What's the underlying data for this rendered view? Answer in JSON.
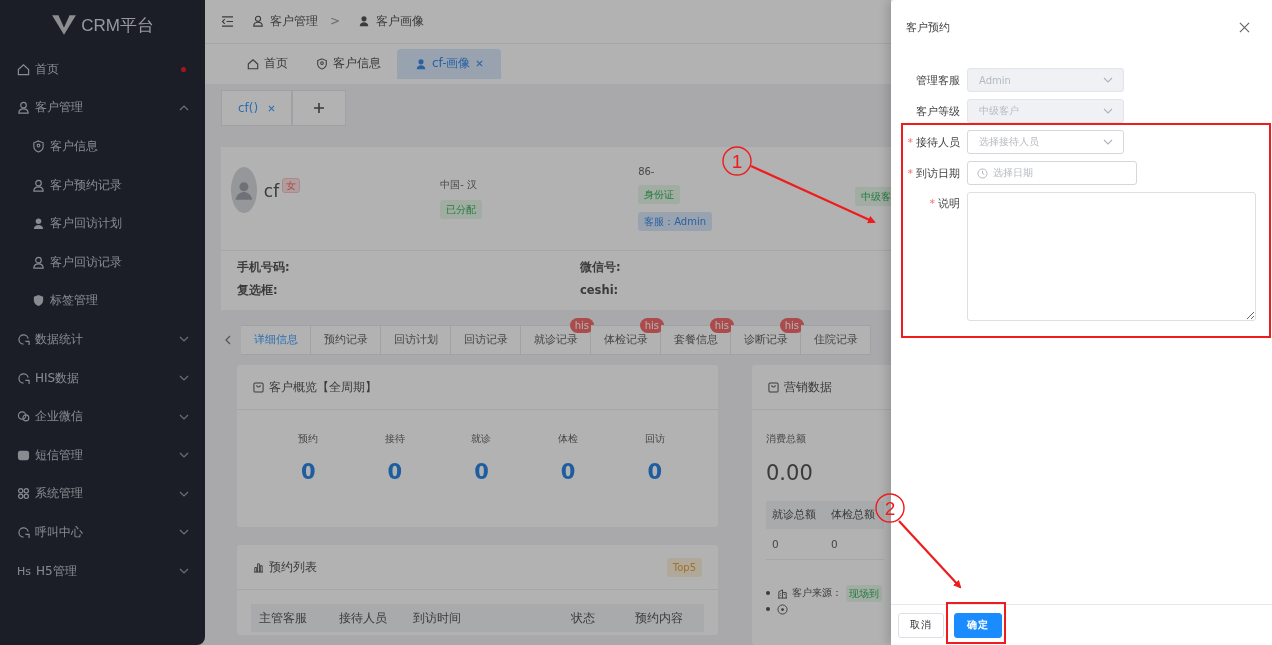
{
  "sidebar": {
    "logo": "CRM平台",
    "items": [
      {
        "label": "首页",
        "dot": true
      },
      {
        "label": "客户管理",
        "expanded": true,
        "children": [
          {
            "label": "客户信息",
            "selected": false
          },
          {
            "label": "客户预约记录",
            "selected": false
          },
          {
            "label": "客户回访计划",
            "selected": false
          },
          {
            "label": "客户回访记录",
            "selected": false
          },
          {
            "label": "标签管理",
            "selected": false
          }
        ]
      },
      {
        "label": "数据统计",
        "expanded": false
      },
      {
        "label": "HIS数据",
        "expanded": false
      },
      {
        "label": "企业微信",
        "expanded": false
      },
      {
        "label": "短信管理",
        "expanded": false
      },
      {
        "label": "系统管理",
        "expanded": false
      },
      {
        "label": "呼叫中心",
        "expanded": false
      },
      {
        "label": "H5管理",
        "icon_text": "Hs",
        "expanded": false
      }
    ]
  },
  "breadcrumb": {
    "items": [
      "客户管理",
      "客户画像"
    ],
    "separator": ">"
  },
  "tabs": [
    {
      "label": "首页",
      "selected": false,
      "closable": false
    },
    {
      "label": "客户信息",
      "selected": false,
      "closable": false
    },
    {
      "label": "cf-画像",
      "selected": true,
      "closable": true
    }
  ],
  "sub_tabs": [
    {
      "label": "cf()",
      "selected": true,
      "closable": true
    }
  ],
  "profile": {
    "name": "cf",
    "gender": "女",
    "origin": "中国- 汉",
    "status_tag": "已分配",
    "phone_code": "86-",
    "id_tag": "身份证",
    "staff_tag": "客服：Admin",
    "level_tag": "中级客",
    "fields": [
      {
        "label": "手机号码:"
      },
      {
        "label": "微信号:"
      },
      {
        "label": "复选框:"
      },
      {
        "label": "ceshi:"
      }
    ]
  },
  "detail_tabs": [
    {
      "label": "详细信息",
      "selected": true
    },
    {
      "label": "预约记录",
      "selected": false
    },
    {
      "label": "回访计划",
      "selected": false
    },
    {
      "label": "回访记录",
      "selected": false
    },
    {
      "label": "就诊记录",
      "selected": false,
      "badge": "his"
    },
    {
      "label": "体检记录",
      "selected": false,
      "badge": "his"
    },
    {
      "label": "套餐信息",
      "selected": false,
      "badge": "his"
    },
    {
      "label": "诊断记录",
      "selected": false,
      "badge": "his"
    },
    {
      "label": "住院记录",
      "selected": false
    }
  ],
  "overview": {
    "title": "客户概览【全周期】",
    "stats": [
      {
        "label": "预约",
        "value": "0"
      },
      {
        "label": "接待",
        "value": "0"
      },
      {
        "label": "就诊",
        "value": "0"
      },
      {
        "label": "体检",
        "value": "0"
      },
      {
        "label": "回访",
        "value": "0"
      }
    ]
  },
  "appointments": {
    "title": "预约列表",
    "tag": "Top5",
    "columns": [
      "主管客服",
      "接待人员",
      "到访时间",
      "状态",
      "预约内容"
    ]
  },
  "marketing": {
    "title": "营销数据",
    "total_label": "消费总额",
    "total": "0.00",
    "columns": [
      "就诊总额",
      "体检总额"
    ],
    "row": [
      "0",
      "0"
    ],
    "list": [
      {
        "kind": "source",
        "label": "客户来源：",
        "tag": "现场到"
      },
      {
        "kind": "location"
      }
    ]
  },
  "drawer": {
    "title": "客户预约",
    "required_mark": "*",
    "fields": [
      {
        "kind": "select",
        "label": "管理客服",
        "value": "Admin",
        "required": false,
        "disabled": true
      },
      {
        "kind": "select",
        "label": "客户等级",
        "value": "中级客户",
        "required": false,
        "disabled": true
      },
      {
        "kind": "select",
        "label": "接待人员",
        "placeholder": "选择接待人员",
        "required": true,
        "disabled": false
      },
      {
        "kind": "date",
        "label": "到访日期",
        "placeholder": "选择日期",
        "required": true,
        "disabled": false
      },
      {
        "kind": "textarea",
        "label": "说明",
        "required": true,
        "disabled": false
      }
    ],
    "buttons": [
      {
        "label": "取消",
        "kind": "default"
      },
      {
        "label": "确定",
        "kind": "primary"
      }
    ]
  },
  "annotations": [
    {
      "number": "1"
    },
    {
      "number": "2"
    }
  ]
}
